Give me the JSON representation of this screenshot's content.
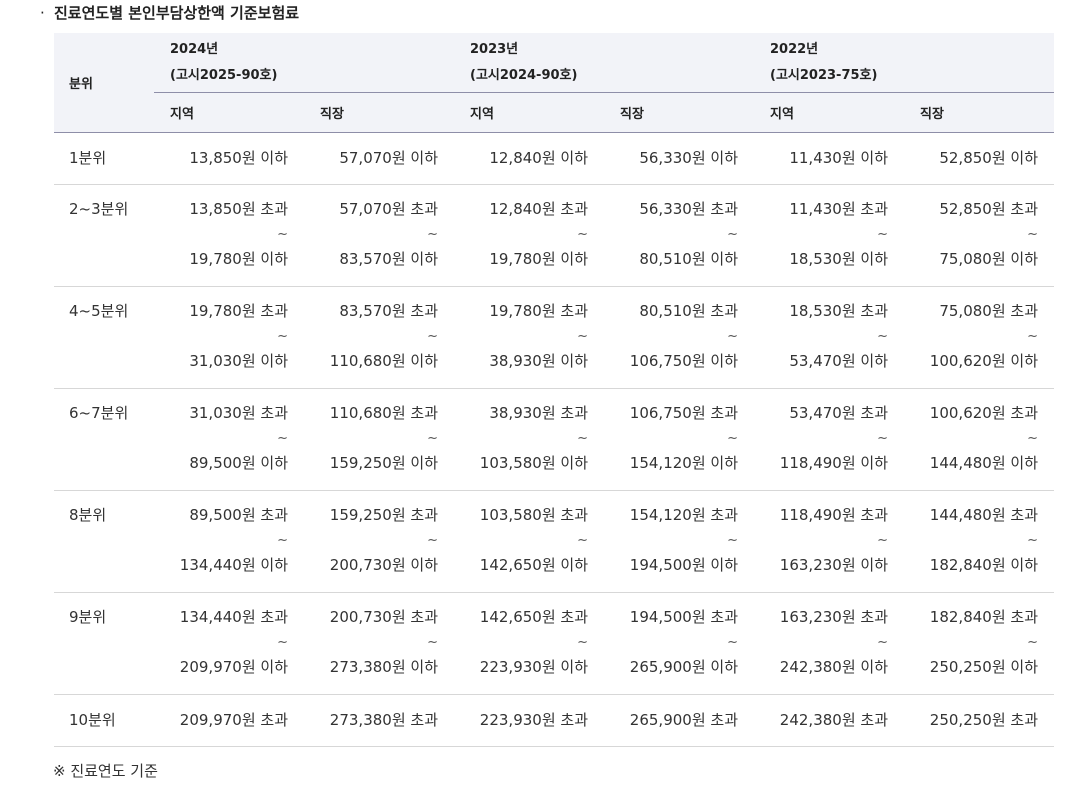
{
  "title": "진료연도별 본인부담상한액 기준보험료",
  "bullet": "·",
  "header": {
    "unit_label": "분위",
    "years": [
      {
        "year": "2024년",
        "notice": "(고시2025-90호)"
      },
      {
        "year": "2023년",
        "notice": "(고시2024-90호)"
      },
      {
        "year": "2022년",
        "notice": "(고시2023-75호)"
      }
    ],
    "sub": [
      "지역",
      "직장",
      "지역",
      "직장",
      "지역",
      "직장"
    ]
  },
  "tilde": "~",
  "rows": [
    {
      "label": "1분위",
      "cells": [
        [
          "13,850원 이하"
        ],
        [
          "57,070원 이하"
        ],
        [
          "12,840원 이하"
        ],
        [
          "56,330원 이하"
        ],
        [
          "11,430원 이하"
        ],
        [
          "52,850원 이하"
        ]
      ]
    },
    {
      "label": "2~3분위",
      "cells": [
        [
          "13,850원 초과",
          "19,780원 이하"
        ],
        [
          "57,070원 초과",
          "83,570원 이하"
        ],
        [
          "12,840원 초과",
          "19,780원 이하"
        ],
        [
          "56,330원 초과",
          "80,510원 이하"
        ],
        [
          "11,430원 초과",
          "18,530원 이하"
        ],
        [
          "52,850원 초과",
          "75,080원 이하"
        ]
      ]
    },
    {
      "label": "4~5분위",
      "cells": [
        [
          "19,780원 초과",
          "31,030원 이하"
        ],
        [
          "83,570원 초과",
          "110,680원 이하"
        ],
        [
          "19,780원 초과",
          "38,930원 이하"
        ],
        [
          "80,510원 초과",
          "106,750원 이하"
        ],
        [
          "18,530원 초과",
          "53,470원 이하"
        ],
        [
          "75,080원 초과",
          "100,620원 이하"
        ]
      ]
    },
    {
      "label": "6~7분위",
      "cells": [
        [
          "31,030원 초과",
          "89,500원 이하"
        ],
        [
          "110,680원 초과",
          "159,250원 이하"
        ],
        [
          "38,930원 초과",
          "103,580원 이하"
        ],
        [
          "106,750원 초과",
          "154,120원 이하"
        ],
        [
          "53,470원 초과",
          "118,490원 이하"
        ],
        [
          "100,620원 초과",
          "144,480원 이하"
        ]
      ]
    },
    {
      "label": "8분위",
      "cells": [
        [
          "89,500원 초과",
          "134,440원 이하"
        ],
        [
          "159,250원 초과",
          "200,730원 이하"
        ],
        [
          "103,580원 초과",
          "142,650원 이하"
        ],
        [
          "154,120원 초과",
          "194,500원 이하"
        ],
        [
          "118,490원 초과",
          "163,230원 이하"
        ],
        [
          "144,480원 초과",
          "182,840원 이하"
        ]
      ]
    },
    {
      "label": "9분위",
      "cells": [
        [
          "134,440원 초과",
          "209,970원 이하"
        ],
        [
          "200,730원 초과",
          "273,380원 이하"
        ],
        [
          "142,650원 초과",
          "223,930원 이하"
        ],
        [
          "194,500원 초과",
          "265,900원 이하"
        ],
        [
          "163,230원 초과",
          "242,380원 이하"
        ],
        [
          "182,840원 초과",
          "250,250원 이하"
        ]
      ]
    },
    {
      "label": "10분위",
      "cells": [
        [
          "209,970원 초과"
        ],
        [
          "273,380원 초과"
        ],
        [
          "223,930원 초과"
        ],
        [
          "265,900원 초과"
        ],
        [
          "242,380원 초과"
        ],
        [
          "250,250원 초과"
        ]
      ]
    }
  ],
  "footnote": "※ 진료연도 기준"
}
